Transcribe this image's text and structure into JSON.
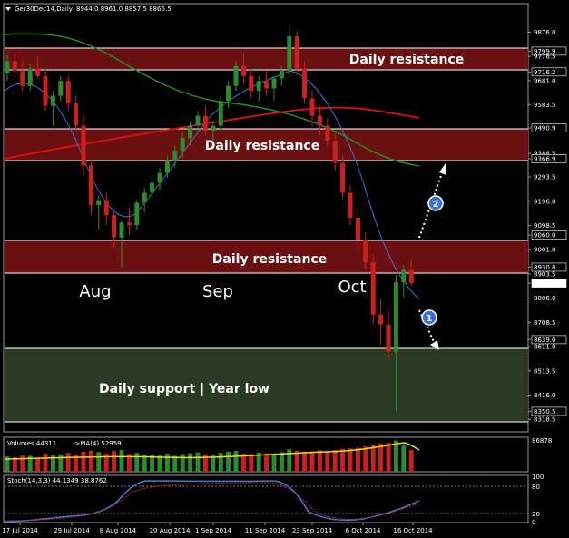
{
  "header": {
    "symbol": "Ger30Dec14,Daily",
    "ohlc": "8944.0 8961.0 8857.5 8866.5",
    "volume_label": "Volumes 44311",
    "volume_ma": "->MA(4) 52959",
    "stoch_label": "Stoch(14,3,3) 44.1349 38.8762"
  },
  "colors": {
    "background": "#000000",
    "bull": "#2e8b2e",
    "bear": "#cc1f1f",
    "resistance_zone": "#6a1010",
    "support_zone": "#2b3a22",
    "ma_fast": "#3b6fd8",
    "ma_red": "#e01010",
    "ma_green": "#238a23",
    "vol_ma": "#f0e000",
    "stoch_main": "#3b7ae0",
    "stoch_signal": "#cc2222"
  },
  "chart_data": {
    "type": "candlestick",
    "price_axis_ticks": [
      "9876.0",
      "9799.9",
      "9778.5",
      "9716.2",
      "9681.0",
      "9583.5",
      "9490.9",
      "9388.5",
      "9366.9",
      "9293.5",
      "9196.0",
      "9098.5",
      "9060.0",
      "9001.0",
      "8930.8",
      "8903.5",
      "8866.5",
      "8806.0",
      "8708.5",
      "8639.0",
      "8611.0",
      "8513.5",
      "8416.0",
      "8350.5",
      "8318.5"
    ],
    "date_ticks": [
      "17 Jul 2014",
      "29 Jul 2014",
      "8 Aug 2014",
      "20 Aug 2014",
      "1 Sep 2014",
      "11 Sep 2014",
      "23 Sep 2014",
      "6 Oct 2014",
      "16 Oct 2014"
    ],
    "month_labels": [
      "Aug",
      "Sep",
      "Oct"
    ],
    "price_range": [
      8290,
      9940
    ],
    "ohlc": [
      [
        9710,
        9790,
        9680,
        9760
      ],
      [
        9760,
        9790,
        9690,
        9720
      ],
      [
        9720,
        9760,
        9640,
        9660
      ],
      [
        9660,
        9750,
        9640,
        9730
      ],
      [
        9730,
        9780,
        9690,
        9700
      ],
      [
        9700,
        9730,
        9560,
        9580
      ],
      [
        9580,
        9640,
        9500,
        9620
      ],
      [
        9620,
        9700,
        9600,
        9680
      ],
      [
        9680,
        9700,
        9560,
        9590
      ],
      [
        9590,
        9620,
        9480,
        9500
      ],
      [
        9500,
        9540,
        9300,
        9340
      ],
      [
        9340,
        9360,
        9140,
        9180
      ],
      [
        9180,
        9220,
        9080,
        9200
      ],
      [
        9200,
        9230,
        9100,
        9140
      ],
      [
        9140,
        9160,
        9010,
        9050
      ],
      [
        9050,
        9120,
        8930,
        9110
      ],
      [
        9110,
        9170,
        9060,
        9100
      ],
      [
        9100,
        9200,
        9080,
        9190
      ],
      [
        9190,
        9250,
        9150,
        9230
      ],
      [
        9230,
        9300,
        9200,
        9270
      ],
      [
        9270,
        9330,
        9240,
        9310
      ],
      [
        9310,
        9380,
        9290,
        9360
      ],
      [
        9360,
        9420,
        9330,
        9400
      ],
      [
        9400,
        9470,
        9370,
        9450
      ],
      [
        9450,
        9520,
        9420,
        9500
      ],
      [
        9500,
        9560,
        9480,
        9540
      ],
      [
        9540,
        9580,
        9460,
        9480
      ],
      [
        9480,
        9520,
        9420,
        9500
      ],
      [
        9500,
        9620,
        9480,
        9600
      ],
      [
        9600,
        9680,
        9570,
        9660
      ],
      [
        9660,
        9760,
        9640,
        9740
      ],
      [
        9740,
        9790,
        9670,
        9700
      ],
      [
        9700,
        9730,
        9610,
        9640
      ],
      [
        9640,
        9700,
        9600,
        9680
      ],
      [
        9680,
        9720,
        9620,
        9650
      ],
      [
        9650,
        9700,
        9600,
        9690
      ],
      [
        9690,
        9740,
        9660,
        9720
      ],
      [
        9720,
        9900,
        9700,
        9860
      ],
      [
        9860,
        9880,
        9700,
        9730
      ],
      [
        9730,
        9760,
        9590,
        9610
      ],
      [
        9610,
        9640,
        9500,
        9540
      ],
      [
        9540,
        9580,
        9460,
        9500
      ],
      [
        9500,
        9530,
        9420,
        9440
      ],
      [
        9440,
        9470,
        9320,
        9350
      ],
      [
        9350,
        9380,
        9210,
        9230
      ],
      [
        9230,
        9260,
        9100,
        9130
      ],
      [
        9130,
        9150,
        9010,
        9040
      ],
      [
        9040,
        9070,
        8920,
        8950
      ],
      [
        8950,
        8980,
        8700,
        8740
      ],
      [
        8740,
        8800,
        8620,
        8700
      ],
      [
        8700,
        8760,
        8560,
        8590
      ],
      [
        8590,
        8900,
        8350,
        8870
      ],
      [
        8870,
        8940,
        8810,
        8920
      ],
      [
        8920,
        8961,
        8857,
        8866
      ]
    ]
  },
  "annotations": {
    "resistance_labels": [
      "Daily resistance",
      "Daily resistance",
      "Daily resistance"
    ],
    "support_label": "Daily support | Year low",
    "marker_1": "1",
    "marker_2": "2",
    "volume_tick": "86878",
    "stoch_ticks": [
      "100",
      "80",
      "20",
      "0"
    ]
  }
}
